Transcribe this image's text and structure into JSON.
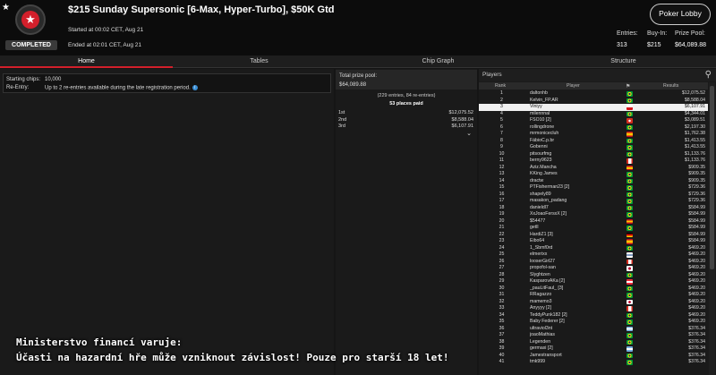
{
  "header": {
    "star_icon": "star-icon",
    "status_badge": "COMPLETED",
    "title": "$215 Sunday Supersonic [6-Max, Hyper-Turbo], $50K Gtd",
    "started": "Started at 00:02 CET, Aug 21",
    "ended": "Ended at 02:01 CET, Aug 21",
    "lobby_button": "Poker Lobby",
    "stats": [
      {
        "label": "Entries:",
        "value": "313"
      },
      {
        "label": "Buy-In:",
        "value": "$215"
      },
      {
        "label": "Prize Pool:",
        "value": "$64,089.88"
      }
    ]
  },
  "tabs": [
    "Home",
    "Tables",
    "Chip Graph",
    "Structure"
  ],
  "info": {
    "starting_chips_label": "Starting chips:",
    "starting_chips_value": "10,000",
    "reentry_label": "Re-Entry:",
    "reentry_value": "Up to 2 re-entries available during the late registration period.",
    "info_icon": "i"
  },
  "prize": {
    "label": "Total prize pool:",
    "value": "$64,089.88",
    "entries_note": "(229 entries, 84 re-entries)",
    "places_paid": "53 places paid",
    "places": [
      {
        "place": "1st",
        "amount": "$12,075.52"
      },
      {
        "place": "2nd",
        "amount": "$8,588.04"
      },
      {
        "place": "3rd",
        "amount": "$6,107.91"
      }
    ],
    "expand_icon": "⌄"
  },
  "players": {
    "title": "Players",
    "columns": {
      "rank": "Rank",
      "player": "Player",
      "result": "Results"
    },
    "rows": [
      {
        "rank": "1",
        "name": "daltonhb",
        "flag": "br",
        "result": "$12,075.52"
      },
      {
        "rank": "2",
        "name": "Kelvin_FP.AR",
        "flag": "br",
        "result": "$8,588.04"
      },
      {
        "rank": "3",
        "name": "Viniyy",
        "flag": "cz",
        "result": "$6,107.91",
        "hl": true
      },
      {
        "rank": "4",
        "name": "milennnal",
        "flag": "br",
        "result": "$4,344.01"
      },
      {
        "rank": "5",
        "name": "FSO10 [2]",
        "flag": "ch",
        "result": "$3,089.51"
      },
      {
        "rank": "6",
        "name": "rollingdrone",
        "flag": "br",
        "result": "$2,197.30"
      },
      {
        "rank": "7",
        "name": "mrmonicecluh",
        "flag": "es",
        "result": "$1,762.38"
      },
      {
        "rank": "8",
        "name": "FábioC.p.br",
        "flag": "br",
        "result": "$1,413.55"
      },
      {
        "rank": "9",
        "name": "Gobenni",
        "flag": "br",
        "result": "$1,413.55"
      },
      {
        "rank": "10",
        "name": "pitsourfmg",
        "flag": "br",
        "result": "$1,133.76"
      },
      {
        "rank": "11",
        "name": "berny9623",
        "flag": "ca",
        "result": "$1,133.76"
      },
      {
        "rank": "12",
        "name": "Aziz.Mancha",
        "flag": "es",
        "result": "$909.35"
      },
      {
        "rank": "13",
        "name": "KKing James",
        "flag": "br",
        "result": "$909.35"
      },
      {
        "rank": "14",
        "name": "dractw",
        "flag": "br",
        "result": "$909.35"
      },
      {
        "rank": "15",
        "name": "PTFisherman23 [2]",
        "flag": "br",
        "result": "$729.36"
      },
      {
        "rank": "16",
        "name": "shapely89",
        "flag": "br",
        "result": "$729.36"
      },
      {
        "rank": "17",
        "name": "masakon_padang",
        "flag": "br",
        "result": "$729.36"
      },
      {
        "rank": "18",
        "name": "danieldl7",
        "flag": "br",
        "result": "$584.99"
      },
      {
        "rank": "19",
        "name": "XxJoaoFersxX [2]",
        "flag": "br",
        "result": "$584.99"
      },
      {
        "rank": "20",
        "name": "$54477",
        "flag": "es",
        "result": "$584.99"
      },
      {
        "rank": "21",
        "name": "getll",
        "flag": "br",
        "result": "$584.99"
      },
      {
        "rank": "22",
        "name": "HardiZ1 [3]",
        "flag": "de",
        "result": "$584.99"
      },
      {
        "rank": "23",
        "name": "Eibo64",
        "flag": "es",
        "result": "$584.99"
      },
      {
        "rank": "24",
        "name": "1_Sbmf0rd",
        "flag": "br",
        "result": "$469.20"
      },
      {
        "rank": "25",
        "name": "elmerixx",
        "flag": "fi",
        "result": "$469.20"
      },
      {
        "rank": "26",
        "name": "looserGirl27",
        "flag": "ca",
        "result": "$469.20"
      },
      {
        "rank": "27",
        "name": "propofol-san",
        "flag": "jp",
        "result": "$469.20"
      },
      {
        "rank": "28",
        "name": "Slyghtzen",
        "flag": "br",
        "result": "$469.20"
      },
      {
        "rank": "29",
        "name": "KasparovAKa [2]",
        "flag": "at",
        "result": "$469.20"
      },
      {
        "rank": "30",
        "name": "_pauLitFaul_ [3]",
        "flag": "br",
        "result": "$469.20"
      },
      {
        "rank": "31",
        "name": "RRagazzo",
        "flag": "br",
        "result": "$469.20"
      },
      {
        "rank": "32",
        "name": "mamemo3",
        "flag": "jp",
        "result": "$469.20"
      },
      {
        "rank": "33",
        "name": "Anyyyy [2]",
        "flag": "ca",
        "result": "$469.20"
      },
      {
        "rank": "34",
        "name": "TeddyPunk182 [2]",
        "flag": "br",
        "result": "$469.20"
      },
      {
        "rank": "35",
        "name": "Baby Federer [2]",
        "flag": "br",
        "result": "$469.20"
      },
      {
        "rank": "36",
        "name": "ultraviol3nt",
        "flag": "ar",
        "result": "$376.34"
      },
      {
        "rank": "37",
        "name": "joaoMathias",
        "flag": "br",
        "result": "$376.34"
      },
      {
        "rank": "38",
        "name": "Legenden",
        "flag": "br",
        "result": "$376.34"
      },
      {
        "rank": "39",
        "name": "germaxi [2]",
        "flag": "ar",
        "result": "$376.34"
      },
      {
        "rank": "40",
        "name": "Jamestransport",
        "flag": "br",
        "result": "$376.34"
      },
      {
        "rank": "41",
        "name": "tmk999",
        "flag": "br",
        "result": "$376.34"
      }
    ]
  },
  "warning": {
    "line1": "Ministerstvo financí varuje:",
    "line2": "Účasti na hazardní hře může vzniknout závislost! Pouze pro starší 18 let!"
  },
  "colors": {
    "accent": "#d31f2b",
    "background": "#151515"
  }
}
